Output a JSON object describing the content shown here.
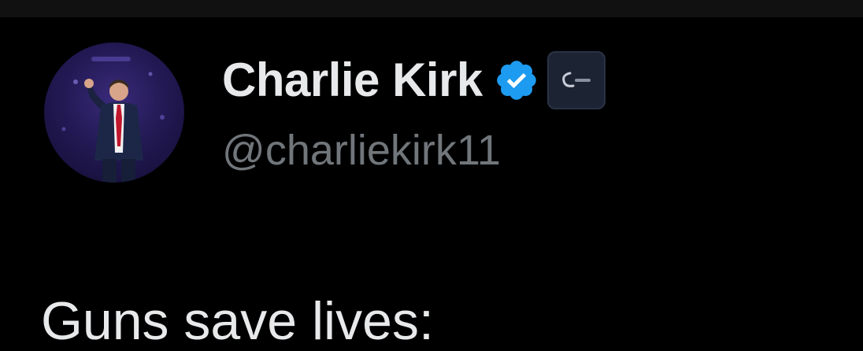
{
  "tweet": {
    "author": {
      "display_name": "Charlie Kirk",
      "handle": "@charliekirk11",
      "verified": true,
      "verified_icon": "verified-check-icon",
      "affiliate_badge_icon": "affiliate-logo-icon"
    },
    "text": "Guns save lives:"
  },
  "colors": {
    "background": "#000000",
    "primary_text": "#e7e9ea",
    "secondary_text": "#71767b",
    "verified_blue": "#1d9bf0"
  }
}
